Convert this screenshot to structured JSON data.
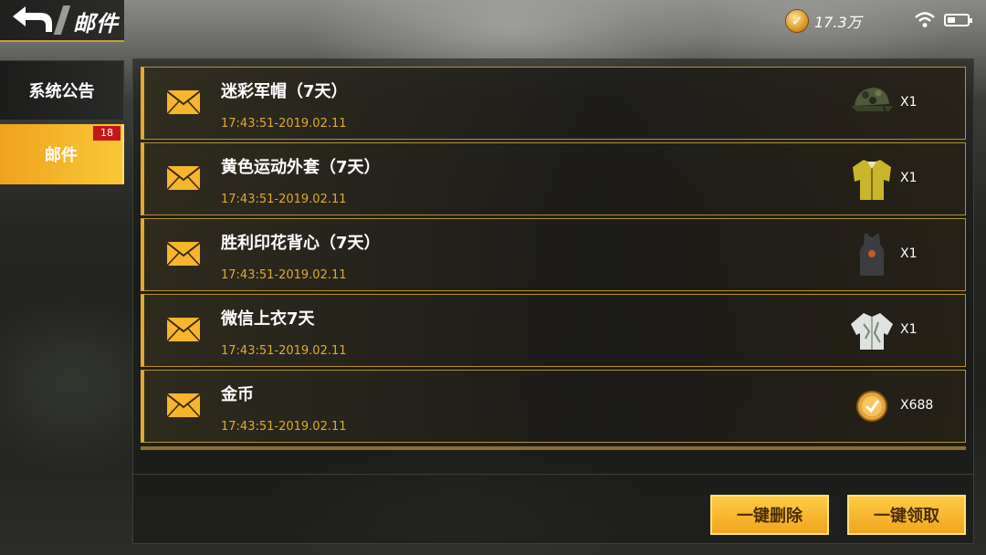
{
  "header": {
    "title": "邮件",
    "back_icon": "back-arrow-icon",
    "currency": {
      "icon": "gold-coin-icon",
      "value": "17.3万"
    },
    "status": {
      "wifi_icon": "wifi-icon",
      "battery_icon": "battery-icon"
    }
  },
  "tabs": [
    {
      "label": "系统公告",
      "selected": false
    },
    {
      "label": "邮件",
      "selected": true,
      "badge": "18"
    }
  ],
  "mails": [
    {
      "title": "迷彩军帽（7天）",
      "time": "17:43:51-2019.02.11",
      "item_icon": "camo-cap-icon",
      "qty": "X1"
    },
    {
      "title": "黄色运动外套（7天）",
      "time": "17:43:51-2019.02.11",
      "item_icon": "yellow-jacket-icon",
      "qty": "X1"
    },
    {
      "title": "胜利印花背心（7天）",
      "time": "17:43:51-2019.02.11",
      "item_icon": "tank-top-icon",
      "qty": "X1"
    },
    {
      "title": "微信上衣7天",
      "time": "17:43:51-2019.02.11",
      "item_icon": "white-jacket-icon",
      "qty": "X1"
    },
    {
      "title": "金币",
      "time": "17:43:51-2019.02.11",
      "item_icon": "gold-coin-icon",
      "qty": "X688"
    }
  ],
  "footer": {
    "delete_all_label": "一键删除",
    "collect_all_label": "一键领取"
  },
  "colors": {
    "accent": "#e0aa2e",
    "badge": "#c2181b",
    "button": "#f5b52d"
  }
}
